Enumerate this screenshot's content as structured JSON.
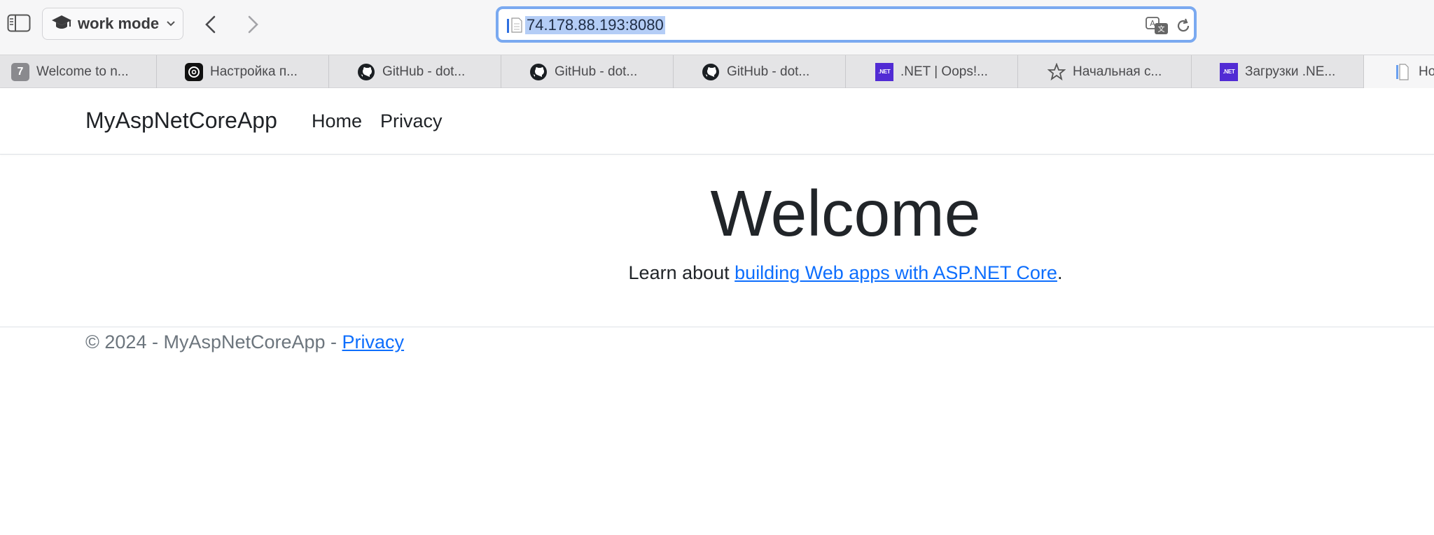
{
  "browser": {
    "profile_label": "work mode",
    "address_url": "74.178.88.193:8080",
    "tabs": [
      {
        "title": "Welcome to n...",
        "favicon": "seven-badge-icon",
        "favicon_text": "7"
      },
      {
        "title": "Настройка п...",
        "favicon": "openai-icon"
      },
      {
        "title": "GitHub - dot...",
        "favicon": "github-icon"
      },
      {
        "title": "GitHub - dot...",
        "favicon": "github-icon"
      },
      {
        "title": "GitHub - dot...",
        "favicon": "github-icon"
      },
      {
        "title": ".NET | Oops!...",
        "favicon": "dotnet-icon",
        "favicon_text": ".NET"
      },
      {
        "title": "Начальная с...",
        "favicon": "star-icon"
      },
      {
        "title": "Загрузки .NE...",
        "favicon": "dotnet-icon",
        "favicon_text": ".NET"
      },
      {
        "title": "Но",
        "favicon": "page-icon"
      }
    ]
  },
  "site": {
    "brand": "MyAspNetCoreApp",
    "nav": {
      "home": "Home",
      "privacy": "Privacy"
    },
    "heading": "Welcome",
    "learn_prefix": "Learn about ",
    "learn_link": "building Web apps with ASP.NET Core",
    "learn_suffix": ".",
    "footer_text": "© 2024 - MyAspNetCoreApp - ",
    "footer_link": "Privacy"
  },
  "colors": {
    "link": "#0d6efd",
    "focus_ring": "#7aa9f0",
    "url_selection": "#b4cdf6",
    "dotnet_brand": "#512bd4"
  }
}
